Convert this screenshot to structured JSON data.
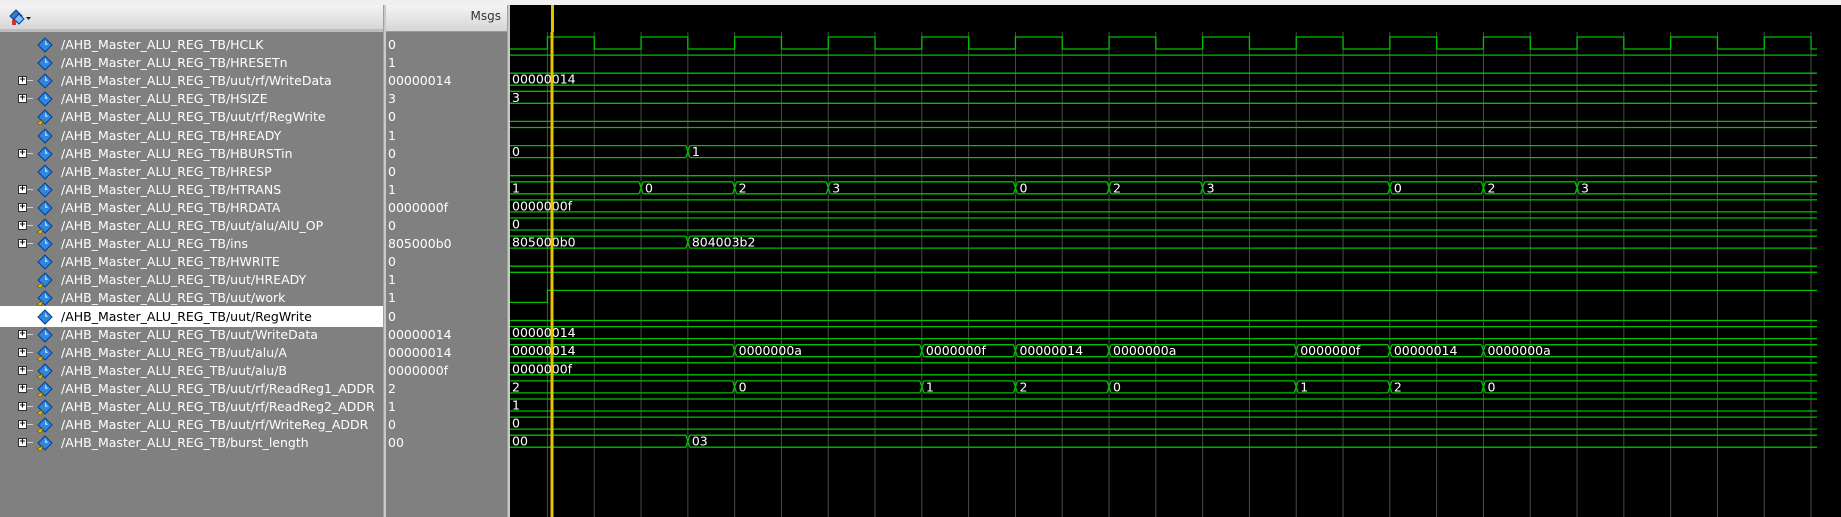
{
  "colors": {
    "wave": "#00c000",
    "grid": "#4a4a4a",
    "cursor": "#e6c200",
    "background": "#000000",
    "panel": "#808080"
  },
  "toolbar": {
    "icon": "wave-signal-dropdown-icon"
  },
  "values_header": {
    "label": "Msgs"
  },
  "cursor_position": 0.1,
  "signals": [
    {
      "name": "/AHB_Master_ALU_REG_TB/HCLK",
      "value": "0",
      "expandable": false,
      "icon": "signal-diamond-icon",
      "wave": {
        "kind": "clock",
        "start_high": false,
        "half_period": 0.5,
        "first_edge": 0.4
      }
    },
    {
      "name": "/AHB_Master_ALU_REG_TB/HRESETn",
      "value": "1",
      "expandable": false,
      "icon": "signal-diamond-icon",
      "wave": {
        "kind": "bit",
        "level": 1,
        "changes": []
      }
    },
    {
      "name": "/AHB_Master_ALU_REG_TB/uut/rf/WriteData",
      "value": "00000014",
      "expandable": true,
      "icon": "signal-diamond-icon",
      "wave": {
        "kind": "bus",
        "segments": [
          {
            "t": 0,
            "label": "00000014"
          }
        ]
      }
    },
    {
      "name": "/AHB_Master_ALU_REG_TB/HSIZE",
      "value": "3",
      "expandable": true,
      "icon": "signal-diamond-icon",
      "wave": {
        "kind": "bus",
        "segments": [
          {
            "t": 0,
            "label": "3"
          }
        ]
      }
    },
    {
      "name": "/AHB_Master_ALU_REG_TB/uut/rf/RegWrite",
      "value": "0",
      "expandable": false,
      "icon": "signal-arrow-diamond-icon",
      "wave": {
        "kind": "bit",
        "level": 0,
        "changes": []
      }
    },
    {
      "name": "/AHB_Master_ALU_REG_TB/HREADY",
      "value": "1",
      "expandable": false,
      "icon": "signal-diamond-icon",
      "wave": {
        "kind": "bit",
        "level": 1,
        "changes": []
      }
    },
    {
      "name": "/AHB_Master_ALU_REG_TB/HBURSTin",
      "value": "0",
      "expandable": true,
      "icon": "signal-diamond-icon",
      "wave": {
        "kind": "bus",
        "segments": [
          {
            "t": 0,
            "label": "0"
          },
          {
            "t": 1.9,
            "label": "1"
          }
        ]
      }
    },
    {
      "name": "/AHB_Master_ALU_REG_TB/HRESP",
      "value": "0",
      "expandable": false,
      "icon": "signal-diamond-icon",
      "wave": {
        "kind": "bit",
        "level": 0,
        "changes": []
      }
    },
    {
      "name": "/AHB_Master_ALU_REG_TB/HTRANS",
      "value": "1",
      "expandable": true,
      "icon": "signal-diamond-icon",
      "wave": {
        "kind": "bus",
        "segments": [
          {
            "t": 0,
            "label": "1"
          },
          {
            "t": 1.4,
            "label": "0"
          },
          {
            "t": 2.4,
            "label": "2"
          },
          {
            "t": 3.4,
            "label": "3"
          },
          {
            "t": 5.4,
            "label": "0"
          },
          {
            "t": 6.4,
            "label": "2"
          },
          {
            "t": 7.4,
            "label": "3"
          },
          {
            "t": 9.4,
            "label": "0"
          },
          {
            "t": 10.4,
            "label": "2"
          },
          {
            "t": 11.4,
            "label": "3"
          }
        ]
      }
    },
    {
      "name": "/AHB_Master_ALU_REG_TB/HRDATA",
      "value": "0000000f",
      "expandable": true,
      "icon": "signal-diamond-icon",
      "wave": {
        "kind": "bus",
        "segments": [
          {
            "t": 0,
            "label": "0000000f"
          }
        ]
      }
    },
    {
      "name": "/AHB_Master_ALU_REG_TB/uut/alu/AlU_OP",
      "value": "0",
      "expandable": true,
      "icon": "signal-arrow-diamond-icon",
      "wave": {
        "kind": "bus",
        "segments": [
          {
            "t": 0,
            "label": "0"
          }
        ]
      }
    },
    {
      "name": "/AHB_Master_ALU_REG_TB/ins",
      "value": "805000b0",
      "expandable": true,
      "icon": "signal-diamond-icon",
      "wave": {
        "kind": "bus",
        "segments": [
          {
            "t": 0,
            "label": "805000b0"
          },
          {
            "t": 1.9,
            "label": "804003b2"
          }
        ]
      }
    },
    {
      "name": "/AHB_Master_ALU_REG_TB/HWRITE",
      "value": "0",
      "expandable": false,
      "icon": "signal-diamond-icon",
      "wave": {
        "kind": "bit",
        "level": 0,
        "changes": []
      }
    },
    {
      "name": "/AHB_Master_ALU_REG_TB/uut/HREADY",
      "value": "1",
      "expandable": false,
      "icon": "signal-arrow-diamond-icon",
      "wave": {
        "kind": "bit",
        "level": 1,
        "changes": []
      }
    },
    {
      "name": "/AHB_Master_ALU_REG_TB/uut/work",
      "value": "1",
      "expandable": false,
      "icon": "signal-arrow-diamond-icon",
      "wave": {
        "kind": "bit",
        "level": 0,
        "changes": [
          0.4
        ]
      }
    },
    {
      "name": "/AHB_Master_ALU_REG_TB/uut/RegWrite",
      "value": "0",
      "expandable": false,
      "icon": "signal-diamond-icon",
      "selected": true,
      "wave": {
        "kind": "bit",
        "level": 0,
        "changes": []
      }
    },
    {
      "name": "/AHB_Master_ALU_REG_TB/uut/WriteData",
      "value": "00000014",
      "expandable": true,
      "icon": "signal-diamond-icon",
      "wave": {
        "kind": "bus",
        "segments": [
          {
            "t": 0,
            "label": "00000014"
          }
        ]
      }
    },
    {
      "name": "/AHB_Master_ALU_REG_TB/uut/alu/A",
      "value": "00000014",
      "expandable": true,
      "icon": "signal-arrow-diamond-icon",
      "wave": {
        "kind": "bus",
        "segments": [
          {
            "t": 0,
            "label": "00000014"
          },
          {
            "t": 2.4,
            "label": "0000000a"
          },
          {
            "t": 4.4,
            "label": "0000000f"
          },
          {
            "t": 5.4,
            "label": "00000014"
          },
          {
            "t": 6.4,
            "label": "0000000a"
          },
          {
            "t": 8.4,
            "label": "0000000f"
          },
          {
            "t": 9.4,
            "label": "00000014"
          },
          {
            "t": 10.4,
            "label": "0000000a"
          }
        ]
      }
    },
    {
      "name": "/AHB_Master_ALU_REG_TB/uut/alu/B",
      "value": "0000000f",
      "expandable": true,
      "icon": "signal-arrow-diamond-icon",
      "wave": {
        "kind": "bus",
        "segments": [
          {
            "t": 0,
            "label": "0000000f"
          }
        ]
      }
    },
    {
      "name": "/AHB_Master_ALU_REG_TB/uut/rf/ReadReg1_ADDR",
      "value": "2",
      "expandable": true,
      "icon": "signal-arrow-diamond-icon",
      "wave": {
        "kind": "bus",
        "segments": [
          {
            "t": 0,
            "label": "2"
          },
          {
            "t": 2.4,
            "label": "0"
          },
          {
            "t": 4.4,
            "label": "1"
          },
          {
            "t": 5.4,
            "label": "2"
          },
          {
            "t": 6.4,
            "label": "0"
          },
          {
            "t": 8.4,
            "label": "1"
          },
          {
            "t": 9.4,
            "label": "2"
          },
          {
            "t": 10.4,
            "label": "0"
          }
        ]
      }
    },
    {
      "name": "/AHB_Master_ALU_REG_TB/uut/rf/ReadReg2_ADDR",
      "value": "1",
      "expandable": true,
      "icon": "signal-arrow-diamond-icon",
      "wave": {
        "kind": "bus",
        "segments": [
          {
            "t": 0,
            "label": "1"
          }
        ]
      }
    },
    {
      "name": "/AHB_Master_ALU_REG_TB/uut/rf/WriteReg_ADDR",
      "value": "0",
      "expandable": true,
      "icon": "signal-arrow-diamond-icon",
      "wave": {
        "kind": "bus",
        "segments": [
          {
            "t": 0,
            "label": "0"
          }
        ]
      }
    },
    {
      "name": "/AHB_Master_ALU_REG_TB/burst_length",
      "value": "00",
      "expandable": true,
      "icon": "signal-arrow-diamond-icon",
      "wave": {
        "kind": "bus",
        "segments": [
          {
            "t": 0,
            "label": "00"
          },
          {
            "t": 1.9,
            "label": "03"
          }
        ]
      }
    }
  ]
}
